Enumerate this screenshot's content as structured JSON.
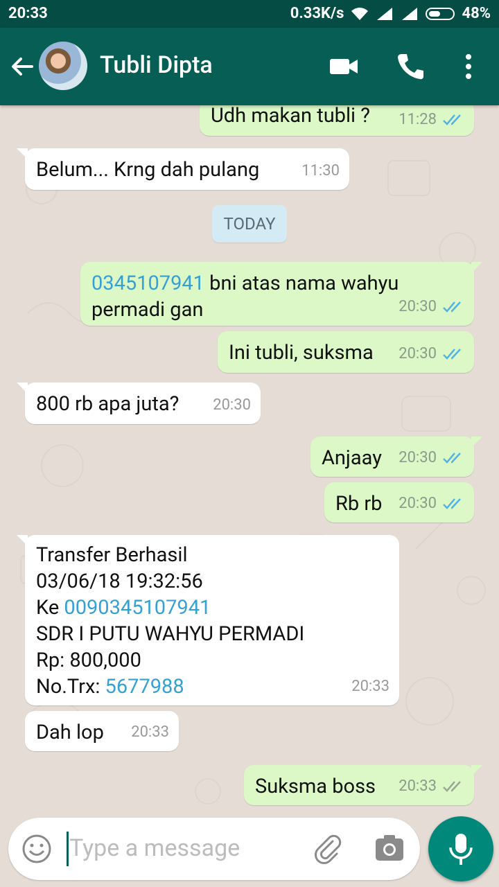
{
  "status_bar": {
    "time": "20:33",
    "net_speed": "0.33K/s",
    "battery": "48%"
  },
  "header": {
    "contact_name": "Tubli Dipta"
  },
  "date_divider": "TODAY",
  "messages": [
    {
      "direction": "out",
      "text": "Udh makan tubli ?",
      "time": "11:28",
      "status": "read"
    },
    {
      "direction": "in",
      "text": "Belum... Krng dah pulang",
      "time": "11:30"
    },
    {
      "direction": "out",
      "link": "0345107941",
      "text_after_link": " bni atas nama wahyu",
      "line2": "permadi gan",
      "time": "20:30",
      "status": "read"
    },
    {
      "direction": "out",
      "text": "Ini tubli, suksma",
      "time": "20:30",
      "status": "read"
    },
    {
      "direction": "in",
      "text": "800 rb apa juta?",
      "time": "20:30"
    },
    {
      "direction": "out",
      "text": "Anjaay",
      "time": "20:30",
      "status": "read"
    },
    {
      "direction": "out",
      "text": "Rb rb",
      "time": "20:30",
      "status": "read"
    },
    {
      "direction": "in",
      "line1": "Transfer Berhasil",
      "line2": "03/06/18 19:32:56",
      "line3_prefix": "Ke ",
      "line3_link": "0090345107941",
      "line4": "SDR I PUTU WAHYU PERMADI",
      "line5": "Rp: 800,000",
      "line6_prefix": "No.Trx: ",
      "line6_link": "5677988",
      "time": "20:33"
    },
    {
      "direction": "in",
      "text": "Dah lop",
      "time": "20:33"
    },
    {
      "direction": "out",
      "text": "Suksma boss",
      "time": "20:33",
      "status": "delivered"
    }
  ],
  "composer": {
    "placeholder": "Type a message"
  },
  "colors": {
    "header": "#075e54",
    "status_bar": "#054d44",
    "outgoing": "#dcf8c6",
    "incoming": "#ffffff",
    "link": "#34a0d6",
    "read_ticks": "#4fb3e8",
    "mic_button": "#00897b"
  }
}
